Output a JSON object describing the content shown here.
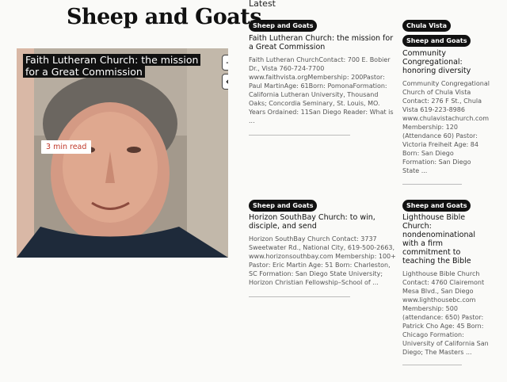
{
  "header": {
    "section_title": "Sheep and Goats"
  },
  "featured": {
    "title": "Faith Lutheran Church: the mission for a Great Commission",
    "read_time": "3 min read",
    "next_icon": "→",
    "prev_icon": "←"
  },
  "latest": {
    "label": "Latest",
    "articles": [
      {
        "tags": [
          "Sheep and Goats"
        ],
        "title": "Faith Lutheran Church: the mission for a Great Commission",
        "excerpt": "Faith Lutheran ChurchContact: 700 E. Bobier Dr., Vista 760-724-7700 www.faithvista.orgMembership: 200Pastor: Paul MartinAge: 61Born: PomonaFormation: California Lutheran University, Thousand Oaks; Concordia Seminary, St. Louis, MO. Years Ordained: 11San Diego Reader: What is ..."
      },
      {
        "tags": [
          "Chula Vista",
          "Sheep and Goats"
        ],
        "title": "Community Congregational: honoring diversity",
        "excerpt": "Community Congregational Church of Chula Vista Contact: 276 F St., Chula Vista 619-223-8986 www.chulavistachurch.com Membership: 120 (Attendance 60) Pastor: Victoria Freiheit Age: 84 Born: San Diego Formation: San Diego State ..."
      },
      {
        "tags": [
          "Sheep and Goats"
        ],
        "title": "Horizon SouthBay Church: to win, disciple, and send",
        "excerpt": "Horizon SouthBay Church Contact: 3737 Sweetwater Rd., National City, 619-500-2663, www.horizonsouthbay.com Membership: 100+ Pastor: Eric Martin Age: 51 Born: Charleston, SC Formation: San Diego State University; Horizon Christian Fellowship–School of ..."
      },
      {
        "tags": [
          "Sheep and Goats"
        ],
        "title": "Lighthouse Bible Church: nondenominational with a firm commitment to teaching the Bible",
        "excerpt": "Lighthouse Bible Church Contact: 4760 Clairemont Mesa Blvd., San Diego www.lighthousebc.com Membership: 500 (attendance: 650) Pastor: Patrick Cho Age: 45 Born: Chicago Formation: University of California San Diego; The Masters ..."
      }
    ]
  }
}
